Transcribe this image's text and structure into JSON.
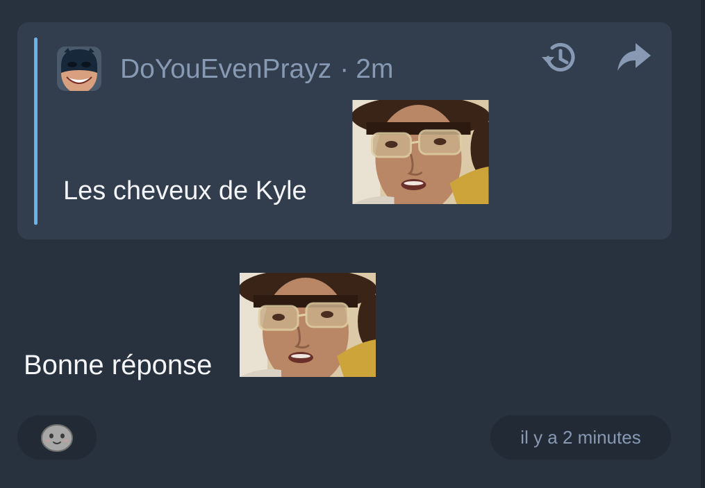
{
  "quoted_message": {
    "author": "DoYouEvenPrayz",
    "separator": "·",
    "age": "2m",
    "text": "Les cheveux de Kyle",
    "avatar_icon": "masked-face-avatar",
    "emote_icon": "surprised-man-glasses-emote",
    "actions": {
      "history_icon": "history-icon",
      "forward_icon": "forward-arrow-icon"
    },
    "accent_color": "#6cb2ea"
  },
  "message": {
    "text": "Bonne réponse",
    "emote_icon": "surprised-man-glasses-emote"
  },
  "footer": {
    "reaction_icon": "smiley-icon",
    "timestamp": "il y a 2 minutes"
  },
  "colors": {
    "background": "#28313e",
    "card": "#323e4e",
    "pill": "#222a35",
    "muted_text": "#8799b3",
    "text": "#f3f5f8"
  }
}
